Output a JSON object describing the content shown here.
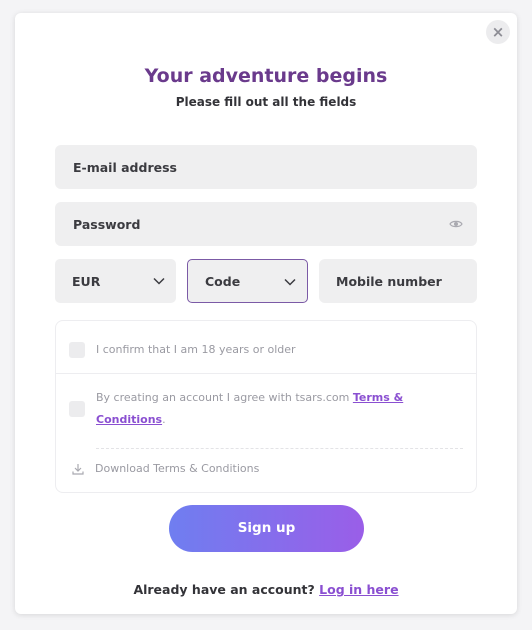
{
  "modal": {
    "close_label": "×",
    "title": "Your adventure begins",
    "subtitle": "Please fill out all the fields"
  },
  "form": {
    "email_placeholder": "E-mail address",
    "password_placeholder": "Password",
    "currency_value": "EUR",
    "code_value": "Code",
    "mobile_placeholder": "Mobile number"
  },
  "consent": {
    "age_label": "I confirm that I am 18 years or older",
    "terms_prefix": "By creating an account I agree with tsars.com ",
    "terms_link": "Terms & Conditions",
    "terms_suffix": ".",
    "download_label": "Download Terms & Conditions"
  },
  "actions": {
    "signup_label": "Sign up",
    "login_prompt": "Already have an account? ",
    "login_link": "Log in here"
  },
  "colors": {
    "title": "#6a3a8c",
    "accent": "#8a4fd1",
    "button_start": "#6f7ef0",
    "button_end": "#9a5ee8"
  },
  "icons": {
    "close": "close-icon",
    "eye": "eye-icon",
    "chevron": "chevron-down-icon",
    "download": "download-icon"
  }
}
